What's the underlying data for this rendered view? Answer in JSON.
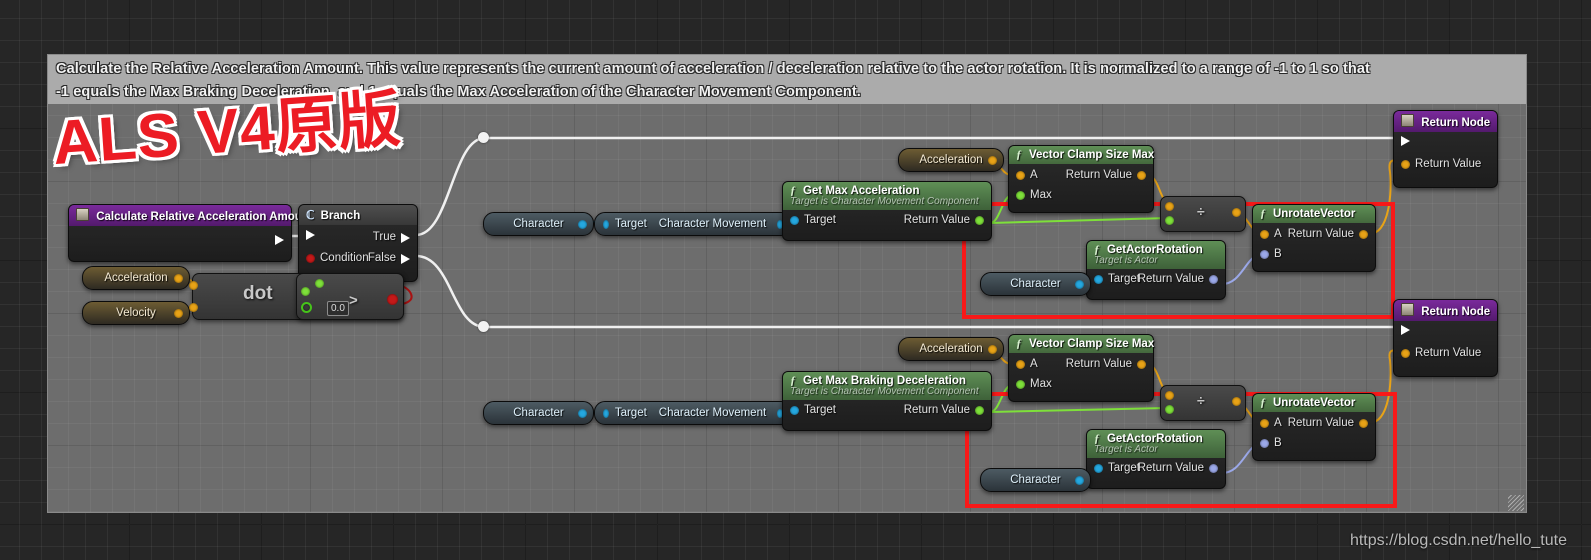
{
  "comment": {
    "line1": "Calculate the Relative Acceleration Amount. This value represents the current amount of acceleration / deceleration relative to the actor rotation. It is normalized to a range of -1 to 1 so that",
    "line2": "-1 equals the Max Braking Deceleration, and 1 equals the Max Acceleration of the Character Movement Component."
  },
  "watermarks": {
    "als": "ALS V4原版",
    "url": "https://blog.csdn.net/hello_tute"
  },
  "nodes": {
    "event": {
      "title": "Calculate Relative Acceleration Amount"
    },
    "branch": {
      "title": "Branch",
      "condition": "Condition",
      "true": "True",
      "false": "False"
    },
    "acceleration_var": {
      "label": "Acceleration"
    },
    "velocity_var": {
      "label": "Velocity"
    },
    "dot": {
      "glyph": "dot",
      "compare": ">",
      "value": "0.0"
    },
    "top": {
      "character_pill": "Character",
      "char_movement_target": "Target",
      "char_movement_label": "Character Movement",
      "get_max": {
        "title": "Get Max Acceleration",
        "subtitle": "Target is Character Movement Component",
        "target": "Target",
        "return": "Return Value"
      },
      "accel_reroute": "Acceleration",
      "clamp": {
        "title": "Vector Clamp Size Max",
        "a": "A",
        "max": "Max",
        "return": "Return Value"
      },
      "divide": {
        "glyph": "÷"
      },
      "get_rot": {
        "title": "GetActorRotation",
        "subtitle": "Target is Actor",
        "character_pill": "Character",
        "target": "Target",
        "return": "Return Value"
      },
      "unrotate": {
        "title": "UnrotateVector",
        "a": "A",
        "b": "B",
        "return": "Return Value"
      },
      "return_node": {
        "title": "Return Node",
        "return_value": "Return Value"
      }
    },
    "bottom": {
      "character_pill": "Character",
      "char_movement_target": "Target",
      "char_movement_label": "Character Movement",
      "get_max": {
        "title": "Get Max Braking Deceleration",
        "subtitle": "Target is Character Movement Component",
        "target": "Target",
        "return": "Return Value"
      },
      "accel_reroute": "Acceleration",
      "clamp": {
        "title": "Vector Clamp Size Max",
        "a": "A",
        "max": "Max",
        "return": "Return Value"
      },
      "divide": {
        "glyph": "÷"
      },
      "get_rot": {
        "title": "GetActorRotation",
        "subtitle": "Target is Actor",
        "character_pill": "Character",
        "target": "Target",
        "return": "Return Value"
      },
      "unrotate": {
        "title": "UnrotateVector",
        "a": "A",
        "b": "B",
        "return": "Return Value"
      },
      "return_node": {
        "title": "Return Node",
        "return_value": "Return Value"
      }
    }
  },
  "colors": {
    "exec_wire": "#f0f0f0",
    "object_wire": "#25a8e0",
    "float_wire": "#7ee03a",
    "vector_wire": "#f0b429",
    "bool_wire": "#a81212",
    "rotator_wire": "#9ba8e8",
    "selection": "#f81919",
    "comment_bg": "#6d6d6d",
    "comment_header": "#ababab"
  }
}
